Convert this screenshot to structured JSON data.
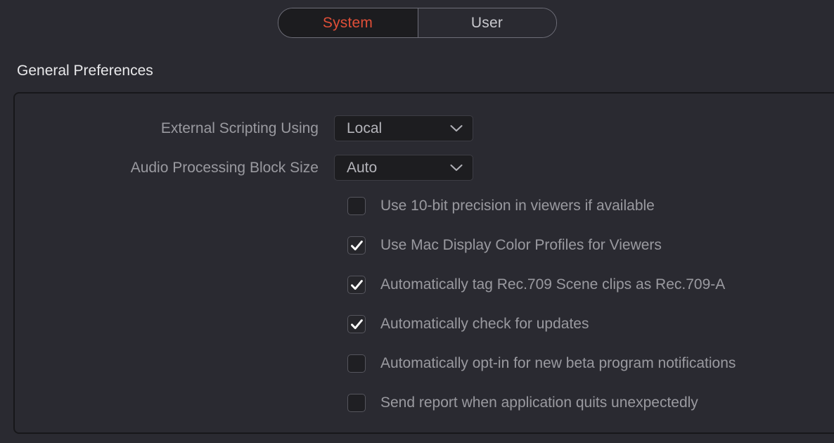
{
  "tabs": {
    "items": [
      {
        "label": "System",
        "active": true
      },
      {
        "label": "User",
        "active": false
      }
    ],
    "active_color": "#e04f38",
    "inactive_color": "#c9c9ce"
  },
  "section": {
    "heading": "General Preferences"
  },
  "fields": [
    {
      "label": "External Scripting Using",
      "value": "Local",
      "icon": "chevron-down-icon",
      "name": "external-scripting-using"
    },
    {
      "label": "Audio Processing Block Size",
      "value": "Auto",
      "icon": "chevron-down-icon",
      "name": "audio-processing-block-size"
    }
  ],
  "checkboxes": [
    {
      "label": "Use 10-bit precision in viewers if available",
      "checked": false,
      "name": "use-10-bit-precision"
    },
    {
      "label": "Use Mac Display Color Profiles for Viewers",
      "checked": true,
      "name": "use-mac-display-color-profiles"
    },
    {
      "label": "Automatically tag Rec.709 Scene clips as Rec.709-A",
      "checked": true,
      "name": "auto-tag-rec709-scene-clips"
    },
    {
      "label": "Automatically check for updates",
      "checked": true,
      "name": "auto-check-for-updates"
    },
    {
      "label": "Automatically opt-in for new beta program notifications",
      "checked": false,
      "name": "auto-opt-in-beta-program"
    },
    {
      "label": "Send report when application quits unexpectedly",
      "checked": false,
      "name": "send-crash-report"
    }
  ]
}
